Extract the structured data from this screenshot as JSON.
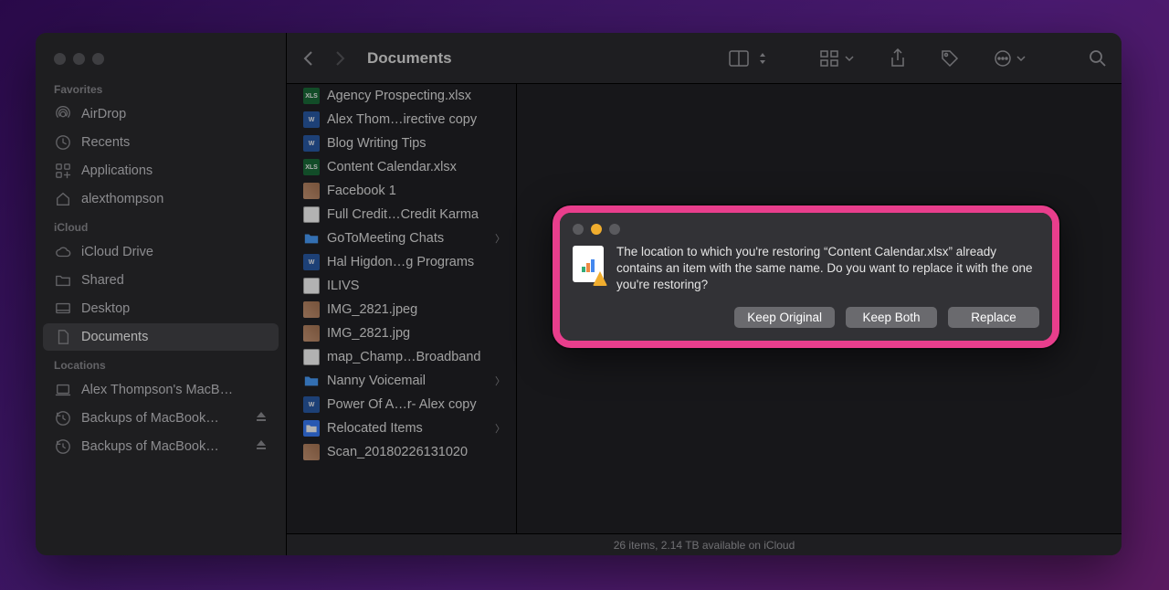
{
  "title": "Documents",
  "sidebar": {
    "sections": [
      {
        "title": "Favorites",
        "items": [
          {
            "icon": "airdrop",
            "label": "AirDrop"
          },
          {
            "icon": "clock",
            "label": "Recents"
          },
          {
            "icon": "apps",
            "label": "Applications"
          },
          {
            "icon": "home",
            "label": "alexthompson"
          }
        ]
      },
      {
        "title": "iCloud",
        "items": [
          {
            "icon": "cloud",
            "label": "iCloud Drive"
          },
          {
            "icon": "folder",
            "label": "Shared"
          },
          {
            "icon": "desktop",
            "label": "Desktop"
          },
          {
            "icon": "doc",
            "label": "Documents",
            "selected": true
          }
        ]
      },
      {
        "title": "Locations",
        "items": [
          {
            "icon": "laptop",
            "label": "Alex Thompson's MacB…"
          },
          {
            "icon": "timemachine",
            "label": "Backups of MacBook…",
            "eject": true
          },
          {
            "icon": "timemachine",
            "label": "Backups of MacBook…",
            "eject": true
          }
        ]
      }
    ]
  },
  "files": [
    {
      "icon": "xls",
      "name": "Agency Prospecting.xlsx"
    },
    {
      "icon": "doc",
      "name": "Alex Thom…irective copy"
    },
    {
      "icon": "doc",
      "name": "Blog Writing Tips"
    },
    {
      "icon": "xls",
      "name": "Content Calendar.xlsx"
    },
    {
      "icon": "img",
      "name": "Facebook 1"
    },
    {
      "icon": "pdf",
      "name": "Full Credit…Credit Karma"
    },
    {
      "icon": "folder",
      "name": "GoToMeeting Chats",
      "children": true
    },
    {
      "icon": "doc",
      "name": "Hal Higdon…g Programs"
    },
    {
      "icon": "generic",
      "name": "ILIVS"
    },
    {
      "icon": "img",
      "name": "IMG_2821.jpeg"
    },
    {
      "icon": "img",
      "name": "IMG_2821.jpg"
    },
    {
      "icon": "generic",
      "name": "map_Champ…Broadband"
    },
    {
      "icon": "folder",
      "name": "Nanny Voicemail",
      "children": true
    },
    {
      "icon": "doc",
      "name": "Power Of A…r- Alex copy"
    },
    {
      "icon": "appf",
      "name": "Relocated Items",
      "children": true
    },
    {
      "icon": "img",
      "name": "Scan_20180226131020"
    }
  ],
  "status": "26 items, 2.14 TB available on iCloud",
  "dialog": {
    "message": "The location to which you're restoring “Content Calendar.xlsx” already contains an item with the same name. Do you want to replace it with the one you're restoring?",
    "buttons": [
      "Keep Original",
      "Keep Both",
      "Replace"
    ]
  }
}
